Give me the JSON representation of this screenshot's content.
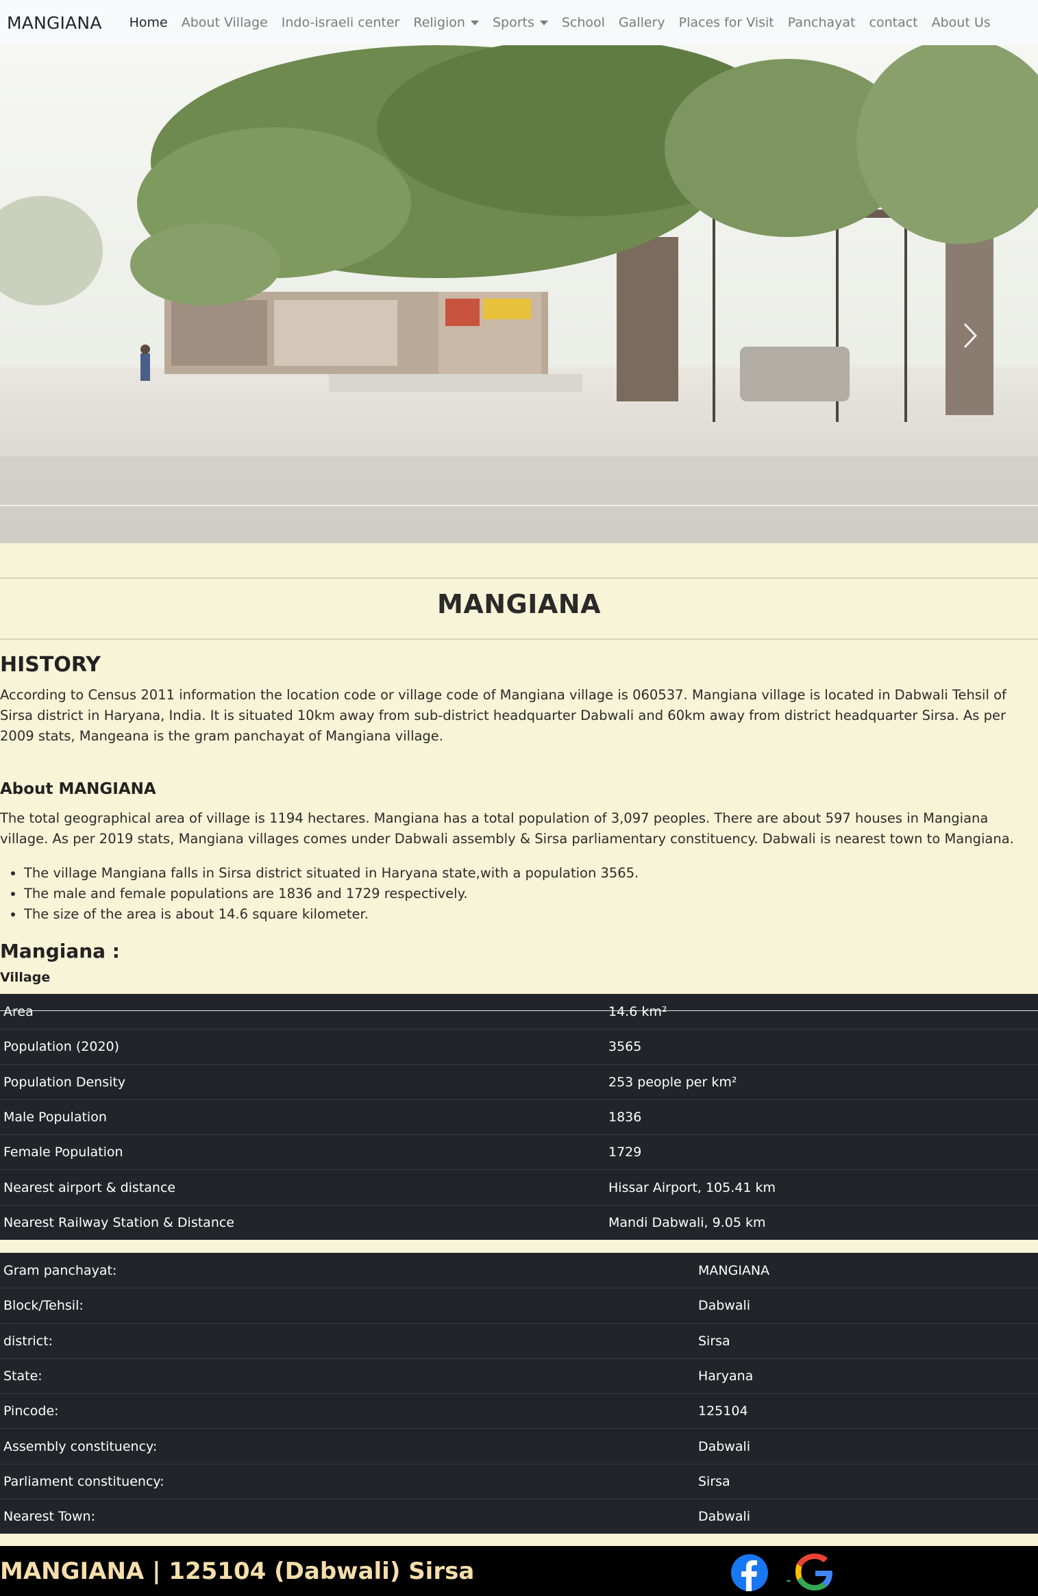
{
  "nav": {
    "brand": "MANGIANA",
    "links": [
      {
        "label": "Home",
        "active": true
      },
      {
        "label": "About Village"
      },
      {
        "label": "Indo-israeli center"
      },
      {
        "label": "Religion",
        "dropdown": true
      },
      {
        "label": "Sports",
        "dropdown": true
      },
      {
        "label": "School"
      },
      {
        "label": "Gallery"
      },
      {
        "label": "Places for Visit"
      },
      {
        "label": "Panchayat"
      },
      {
        "label": "contact"
      },
      {
        "label": "About Us"
      }
    ]
  },
  "hero": {
    "carousel_next_icon": "chevron-right-icon"
  },
  "main": {
    "title": "MANGIANA",
    "history_heading": "HISTORY",
    "history_text": "According to Census 2011 information the location code or village code of Mangiana village is 060537. Mangiana village is located in Dabwali Tehsil of Sirsa district in Haryana, India. It is situated 10km away from sub-district headquarter Dabwali and 60km away from district headquarter Sirsa. As per 2009 stats, Mangeana is the gram panchayat of Mangiana village.",
    "about_heading": "About MANGIANA",
    "about_text": "The total geographical area of village is 1194 hectares. Mangiana has a total population of 3,097 peoples. There are about 597 houses in Mangiana village. As per 2019 stats, Mangiana villages comes under Dabwali assembly & Sirsa parliamentary constituency. Dabwali is nearest town to Mangiana.",
    "bullets": [
      "The village Mangiana falls in Sirsa district situated in Haryana state,with a population 3565.",
      "The male and female populations are 1836 and 1729 respectively.",
      "The size of the area is about 14.6 square kilometer."
    ],
    "mangiana_heading": "Mangiana :",
    "village_label": "Village"
  },
  "stats_table": [
    [
      "Area",
      "14.6 km²"
    ],
    [
      "Population (2020)",
      "3565"
    ],
    [
      "Population Density",
      "253 people per km²"
    ],
    [
      "Male Population",
      "1836"
    ],
    [
      "Female Population",
      "1729"
    ],
    [
      "Nearest airport & distance",
      "Hissar Airport, 105.41 km"
    ],
    [
      "Nearest Railway Station & Distance",
      "Mandi Dabwali, 9.05 km"
    ]
  ],
  "info_table": [
    [
      "Gram panchayat:",
      "MANGIANA"
    ],
    [
      "Block/Tehsil:",
      "Dabwali"
    ],
    [
      "district:",
      "Sirsa"
    ],
    [
      "State:",
      "Haryana"
    ],
    [
      "Pincode:",
      "125104"
    ],
    [
      "Assembly constituency:",
      "Dabwali"
    ],
    [
      "Parliament constituency:",
      "Sirsa"
    ],
    [
      "Nearest Town:",
      "Dabwali"
    ]
  ],
  "footer": {
    "text": "MANGIANA | 125104 (Dabwali) Sirsa",
    "facebook_icon": "facebook-icon",
    "google_icon": "google-icon"
  },
  "colors": {
    "page_bg": "#f8f4d7",
    "navbar_bg": "#f8f9fa",
    "table_bg": "#212529",
    "footer_bg": "#000000",
    "footer_text": "#f5deaa"
  }
}
